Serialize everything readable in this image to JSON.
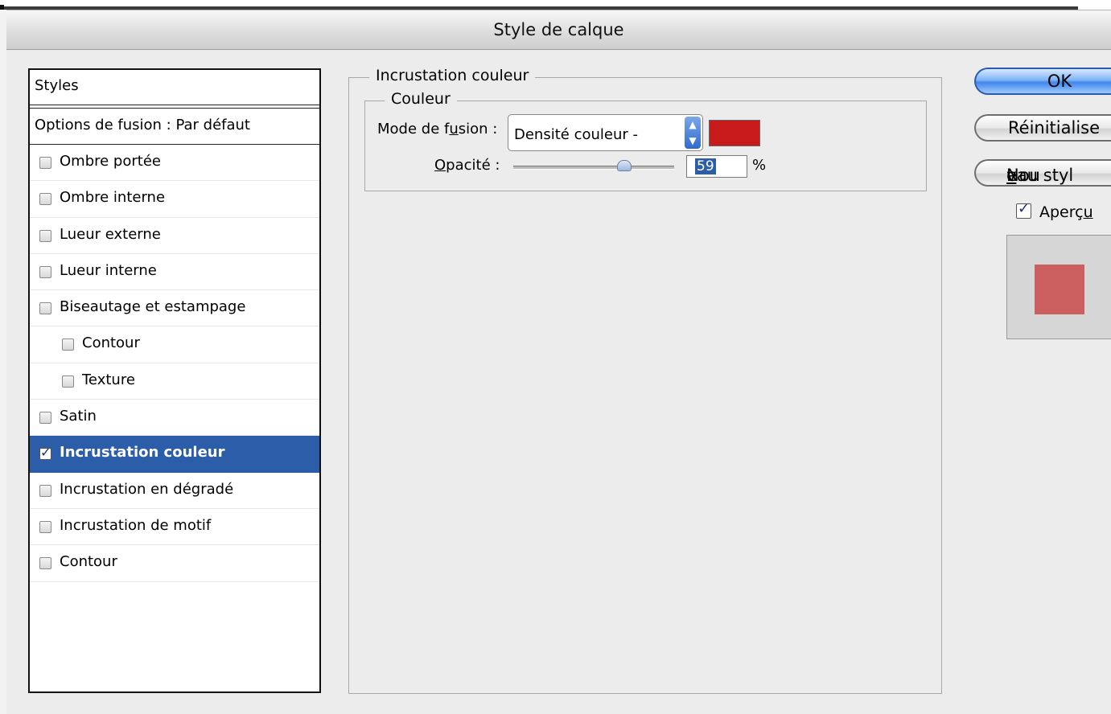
{
  "window": {
    "title": "Style de calque"
  },
  "styles_panel": {
    "header": "Styles",
    "blending_options": "Options de fusion : Par défaut",
    "items": [
      {
        "label": "Ombre portée",
        "checked": false,
        "indent": false
      },
      {
        "label": "Ombre interne",
        "checked": false,
        "indent": false
      },
      {
        "label": "Lueur externe",
        "checked": false,
        "indent": false
      },
      {
        "label": "Lueur interne",
        "checked": false,
        "indent": false
      },
      {
        "label": "Biseautage et estampage",
        "checked": false,
        "indent": false
      },
      {
        "label": "Contour",
        "checked": false,
        "indent": true
      },
      {
        "label": "Texture",
        "checked": false,
        "indent": true
      },
      {
        "label": "Satin",
        "checked": false,
        "indent": false
      },
      {
        "label": "Incrustation couleur",
        "checked": true,
        "indent": false,
        "selected": true
      },
      {
        "label": "Incrustation en dégradé",
        "checked": false,
        "indent": false
      },
      {
        "label": "Incrustation de motif",
        "checked": false,
        "indent": false
      },
      {
        "label": "Contour",
        "checked": false,
        "indent": false
      }
    ]
  },
  "settings": {
    "group_title": "Incrustation couleur",
    "subgroup_title": "Couleur",
    "mode_label_pre": "Mode de f",
    "mode_label_u": "u",
    "mode_label_post": "sion :",
    "mode_value": "Densité couleur -",
    "overlay_color": "#c81a1a",
    "opacity_label_u": "O",
    "opacity_label_post": "pacité :",
    "opacity_value": "59",
    "opacity_unit": "%"
  },
  "buttons": {
    "ok": "OK",
    "reset": "Réinitialise",
    "new_style_pre": "Nou",
    "new_style_u": "v",
    "new_style_post": "eau styl"
  },
  "preview": {
    "label_pre": "Aperç",
    "label_u": "u",
    "checked": true,
    "swatch_color": "#cc6060"
  },
  "colors": {
    "selection": "#2b5da8"
  }
}
